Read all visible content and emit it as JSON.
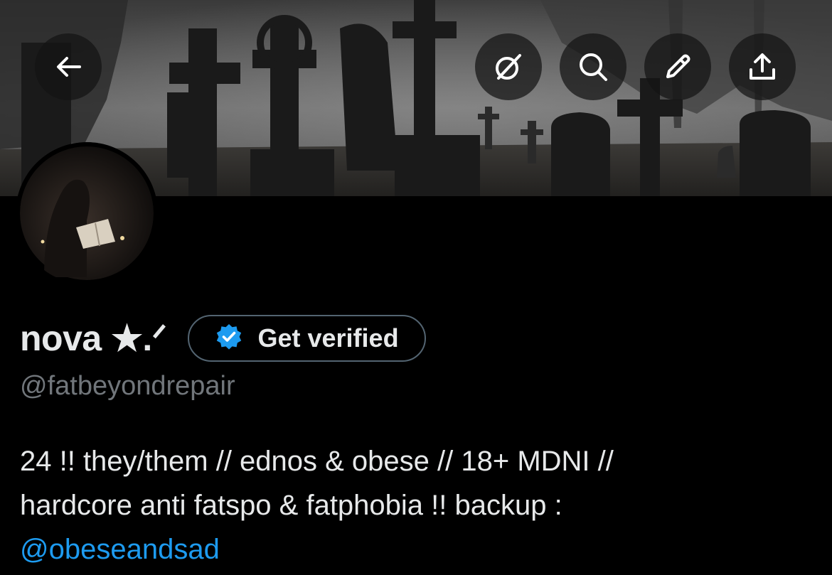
{
  "header": {
    "back_icon": "arrow-left-icon",
    "actions": [
      {
        "icon": "grok-slash-circle-icon"
      },
      {
        "icon": "search-icon"
      },
      {
        "icon": "pencil-icon"
      },
      {
        "icon": "share-upload-icon"
      }
    ]
  },
  "profile": {
    "display_name": "nova ★.ᐟ",
    "verify_button_label": "Get verified",
    "verified_badge_color": "#1d9bf0",
    "handle": "@fatbeyondrepair",
    "bio_line_1": "24 !! they/them // ednos & obese // 18+ MDNI //",
    "bio_line_2": "hardcore anti fatspo & fatphobia !! backup :",
    "bio_mention": "@obeseandsad"
  },
  "colors": {
    "background": "#000000",
    "text_primary": "#e7e9ea",
    "text_secondary": "#71767b",
    "link": "#1d9bf0",
    "button_border": "#536471"
  }
}
